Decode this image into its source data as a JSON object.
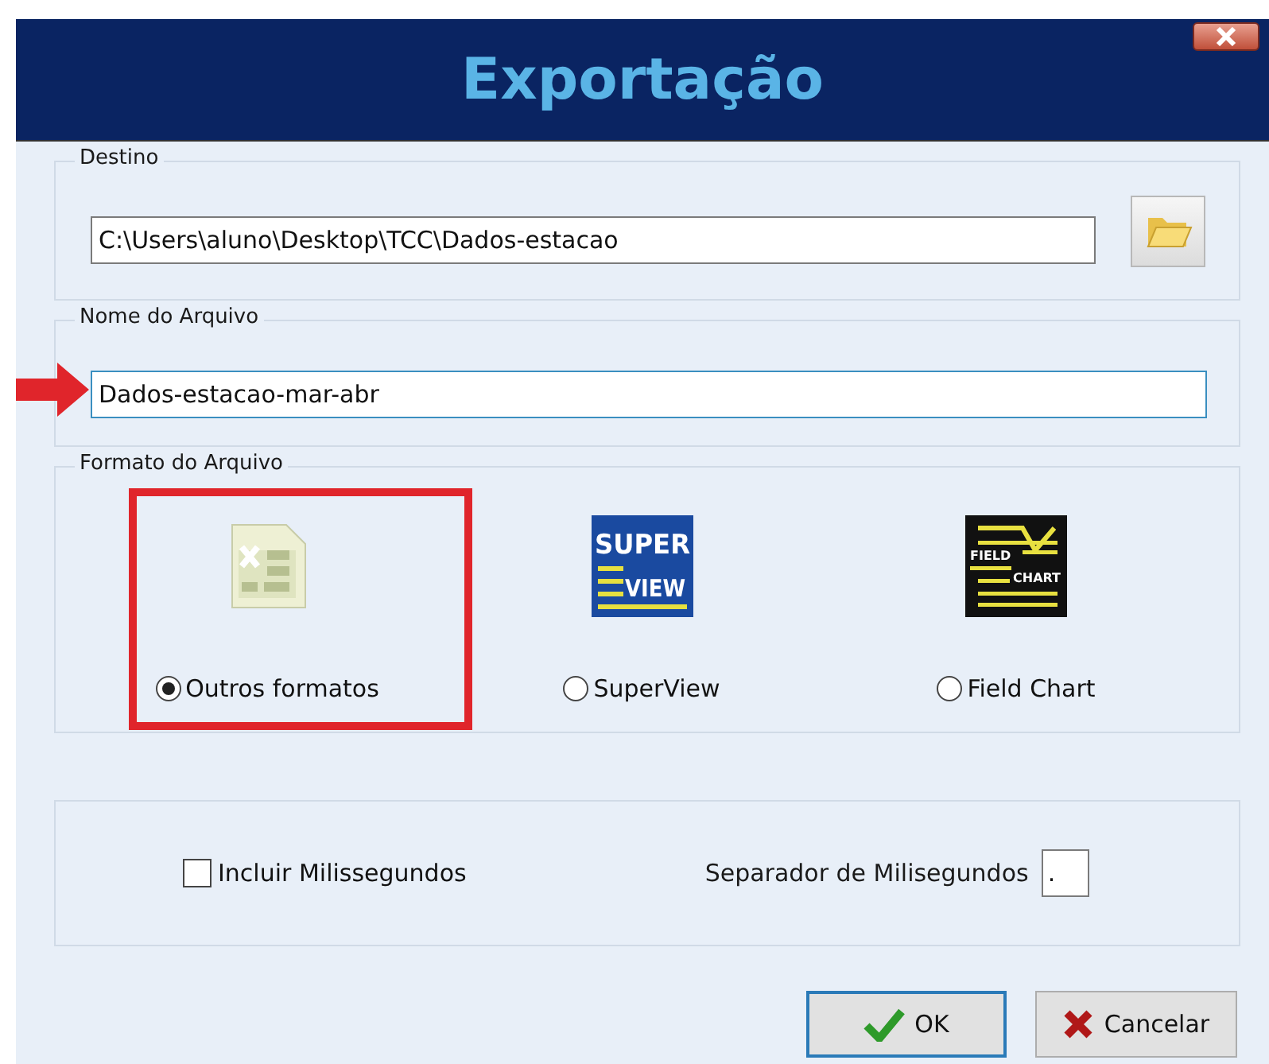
{
  "window": {
    "title": "Exportação"
  },
  "destination": {
    "legend": "Destino",
    "value": "C:\\Users\\aluno\\Desktop\\TCC\\Dados-estacao"
  },
  "file_name": {
    "legend": "Nome do Arquivo",
    "value": "Dados-estacao-mar-abr",
    "arrow_marked": true
  },
  "format": {
    "legend": "Formato do Arquivo",
    "options": [
      {
        "kind": "spreadsheet",
        "label": "Outros formatos",
        "selected": true,
        "highlighted": true
      },
      {
        "kind": "superview",
        "label": "SuperView",
        "selected": false,
        "highlighted": false,
        "logo_text": [
          "SUPER",
          "VIEW"
        ]
      },
      {
        "kind": "fieldchart",
        "label": "Field Chart",
        "selected": false,
        "highlighted": false,
        "logo_text": [
          "FIELD",
          "CHART"
        ]
      }
    ]
  },
  "options": {
    "include_ms": {
      "label": "Incluir Milissegundos",
      "checked": false
    },
    "separator": {
      "label": "Separador de Milisegundos",
      "value": "."
    }
  },
  "buttons": [
    {
      "kind": "ok",
      "label": "OK",
      "focused": true
    },
    {
      "kind": "cancel",
      "label": "Cancelar",
      "focused": false
    }
  ]
}
